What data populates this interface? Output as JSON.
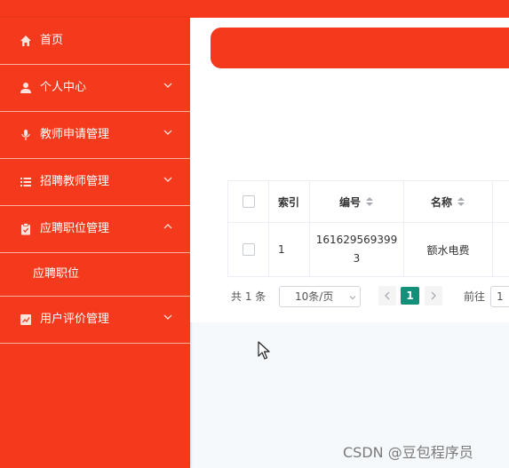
{
  "sidebar": {
    "items": [
      {
        "label": "首页",
        "icon": "home-icon"
      },
      {
        "label": "个人中心",
        "icon": "user-icon"
      },
      {
        "label": "教师申请管理",
        "icon": "microphone-icon"
      },
      {
        "label": "招聘教师管理",
        "icon": "list-icon"
      },
      {
        "label": "应聘职位管理",
        "icon": "clipboard-icon",
        "expanded": true
      },
      {
        "label": "用户评价管理",
        "icon": "chart-icon"
      }
    ],
    "submenu": [
      {
        "label": "应聘职位"
      }
    ]
  },
  "table": {
    "columns": [
      "索引",
      "编号",
      "名称"
    ],
    "rows": [
      {
        "index": "1",
        "id": "1616295693993",
        "name": "额水电费"
      }
    ]
  },
  "pagination": {
    "total": "共 1 条",
    "page_size": "10条/页",
    "current_page": "1",
    "goto_label": "前往",
    "goto_value": "1"
  },
  "watermark": "CSDN @豆包程序员",
  "colors": {
    "primary": "#f4391c",
    "accent": "#13907a"
  }
}
